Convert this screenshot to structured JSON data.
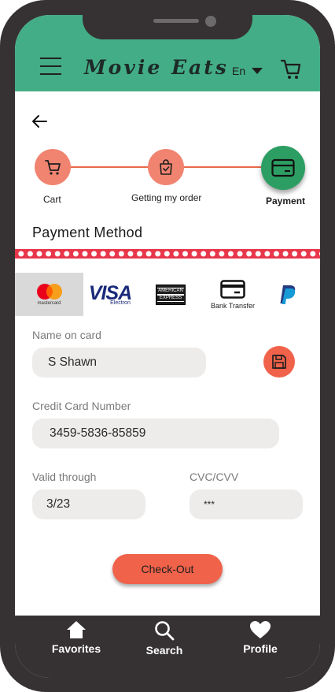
{
  "header": {
    "app_title": "Movie Eats",
    "language": "En",
    "menu_icon": "hamburger-menu-icon",
    "cart_icon": "shopping-cart-icon"
  },
  "checkout_steps": [
    {
      "label": "Cart",
      "icon": "cart-icon",
      "state": "done"
    },
    {
      "label": "Getting my order",
      "icon": "shopping-bag-check-icon",
      "state": "done"
    },
    {
      "label": "Payment",
      "icon": "credit-card-icon",
      "state": "active"
    }
  ],
  "section": {
    "title": "Payment Method"
  },
  "payment_methods": {
    "selected": "Mastercard",
    "mastercard": {
      "label": "mastercard"
    },
    "visa": {
      "label": "VISA",
      "sub": "Electron"
    },
    "amex": {
      "line1": "AMERICAN",
      "line2": "EXPRESS"
    },
    "bank": {
      "label": "Bank Transfer"
    },
    "paypal": {
      "icon": "paypal-icon"
    }
  },
  "form": {
    "name": {
      "label": "Name on card",
      "value": "S Shawn"
    },
    "card_number": {
      "label": "Credit Card Number",
      "value": "3459-5836-85859"
    },
    "valid_through": {
      "label": "Valid through",
      "value": "3/23"
    },
    "cvc": {
      "label": "CVC/CVV",
      "value": "***"
    },
    "save_icon": "save-floppy-icon"
  },
  "actions": {
    "checkout_label": "Check-Out"
  },
  "bottom_nav": [
    {
      "label": "Favorites",
      "icon": "home-icon"
    },
    {
      "label": "Search",
      "icon": "search-icon"
    },
    {
      "label": "Profile",
      "icon": "heart-icon"
    }
  ],
  "colors": {
    "header_green": "#43ad87",
    "accent_coral": "#f0624a",
    "step_done": "#f08470",
    "step_active": "#2d9e63",
    "dotted_red": "#e8364a",
    "bottom_nav_bg": "#363233"
  }
}
